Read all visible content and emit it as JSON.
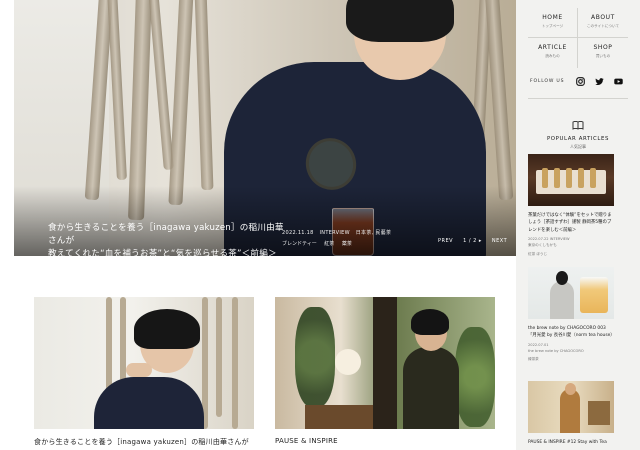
{
  "hero": {
    "title_line1": "食から生きることを養う［inagawa yakuzen］の稲川由華さんが",
    "title_line2": "教えてくれた“血を補うお茶”と“気を巡らせる茶”＜前編＞",
    "date": "2022.11.18",
    "category": "INTERVIEW",
    "location": "日本茶, 民藝茶",
    "tags": [
      "ブレンドティー",
      "紅茶",
      "薬茶"
    ],
    "nav": [
      "PREV",
      "1 / 2  ▸",
      "NEXT"
    ]
  },
  "cards": [
    {
      "title": "食から生きることを養う［inagawa yakuzen］の稲川由華さんが"
    },
    {
      "title": "PAUSE & INSPIRE"
    }
  ],
  "sidebar": {
    "nav": [
      {
        "en": "HOME",
        "ja": "トップページ"
      },
      {
        "en": "ABOUT",
        "ja": "このサイトについて"
      },
      {
        "en": "ARTICLE",
        "ja": "読みもの"
      },
      {
        "en": "SHOP",
        "ja": "買いもの"
      }
    ],
    "follow_label": "FOLLOW US",
    "social_icons": [
      "instagram-icon",
      "twitter-icon",
      "youtube-icon"
    ],
    "popular": {
      "en": "POPULAR ARTICLES",
      "ja": "人気記事",
      "items": [
        {
          "title": "茶葉だけではなく“体験”をセットで贈りましょう［茶話すずわ］謹製 静岡茶5種のブレンドを楽しむ＜前編＞",
          "meta": "2022.07.22  INTERVIEW",
          "meta2": "東京のくしもかも",
          "tags": "紅茶  ほうじ"
        },
        {
          "title": "the brew note by CHAGOCORO 003「月光愛 by 長谷川愛（norm tea house）",
          "meta": "2022.07.01",
          "meta2": "the brew note by CHAGOCORO",
          "tags": "緑茶茶"
        },
        {
          "title": "PAUSE & INSPIRE #12 Stay with Tea",
          "meta": "",
          "meta2": "",
          "tags": ""
        }
      ]
    }
  },
  "colors": {
    "sidebar_bg": "#f2f2f0",
    "hero_text": "#ffffff",
    "body_text": "#222222"
  }
}
